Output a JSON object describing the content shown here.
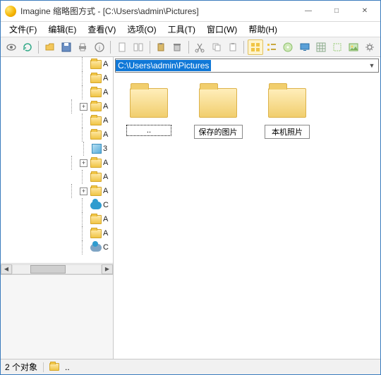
{
  "window": {
    "title": "Imagine 缩略图方式 - [C:\\Users\\admin\\Pictures]"
  },
  "menu": {
    "file": "文件(F)",
    "edit": "编辑(E)",
    "view": "查看(V)",
    "options": "选项(O)",
    "tools": "工具(T)",
    "window": "窗口(W)",
    "help": "帮助(H)"
  },
  "path": {
    "current": "C:\\Users\\admin\\Pictures"
  },
  "thumbs": {
    "up": "..",
    "saved": "保存的图片",
    "local": "本机照片"
  },
  "status": {
    "count": "2 个对象",
    "sel": ".."
  }
}
